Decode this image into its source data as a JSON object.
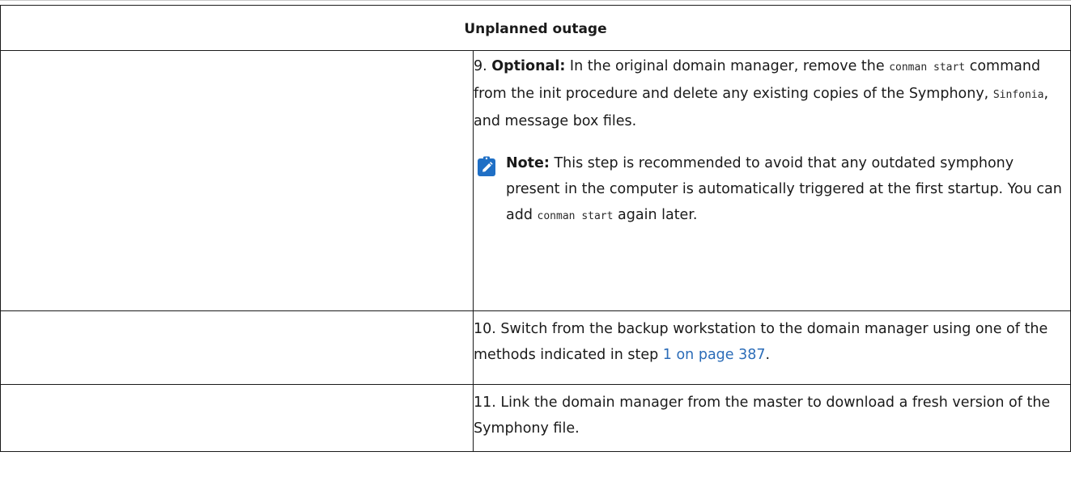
{
  "table": {
    "header": "Unplanned outage",
    "step9": {
      "number": "9.",
      "label": "Optional:",
      "text1": "In the original domain manager, remove the",
      "code1": "conman start",
      "text2": "command from the init procedure and delete any existing copies of the Symphony,",
      "code2": "Sinfonia",
      "text3": ", and message box files.",
      "note": {
        "icon": "pencil-note-icon",
        "label": "Note:",
        "text1": "This step is recommended to avoid that any outdated symphony present in the computer is automatically triggered at the first startup. You can add",
        "code": "conman start",
        "text2": "again later."
      }
    },
    "step10": {
      "number": "10.",
      "text": "Switch from the backup workstation to the domain manager using one of the methods indicated in step",
      "link": "1 on page 387",
      "end": "."
    },
    "step11": {
      "number": "11.",
      "text": "Link the domain manager from the master to download a fresh version of the Symphony file."
    }
  },
  "colors": {
    "link": "#2b6cb8",
    "icon": "#1f6fc5",
    "border": "#1a1a1a"
  }
}
